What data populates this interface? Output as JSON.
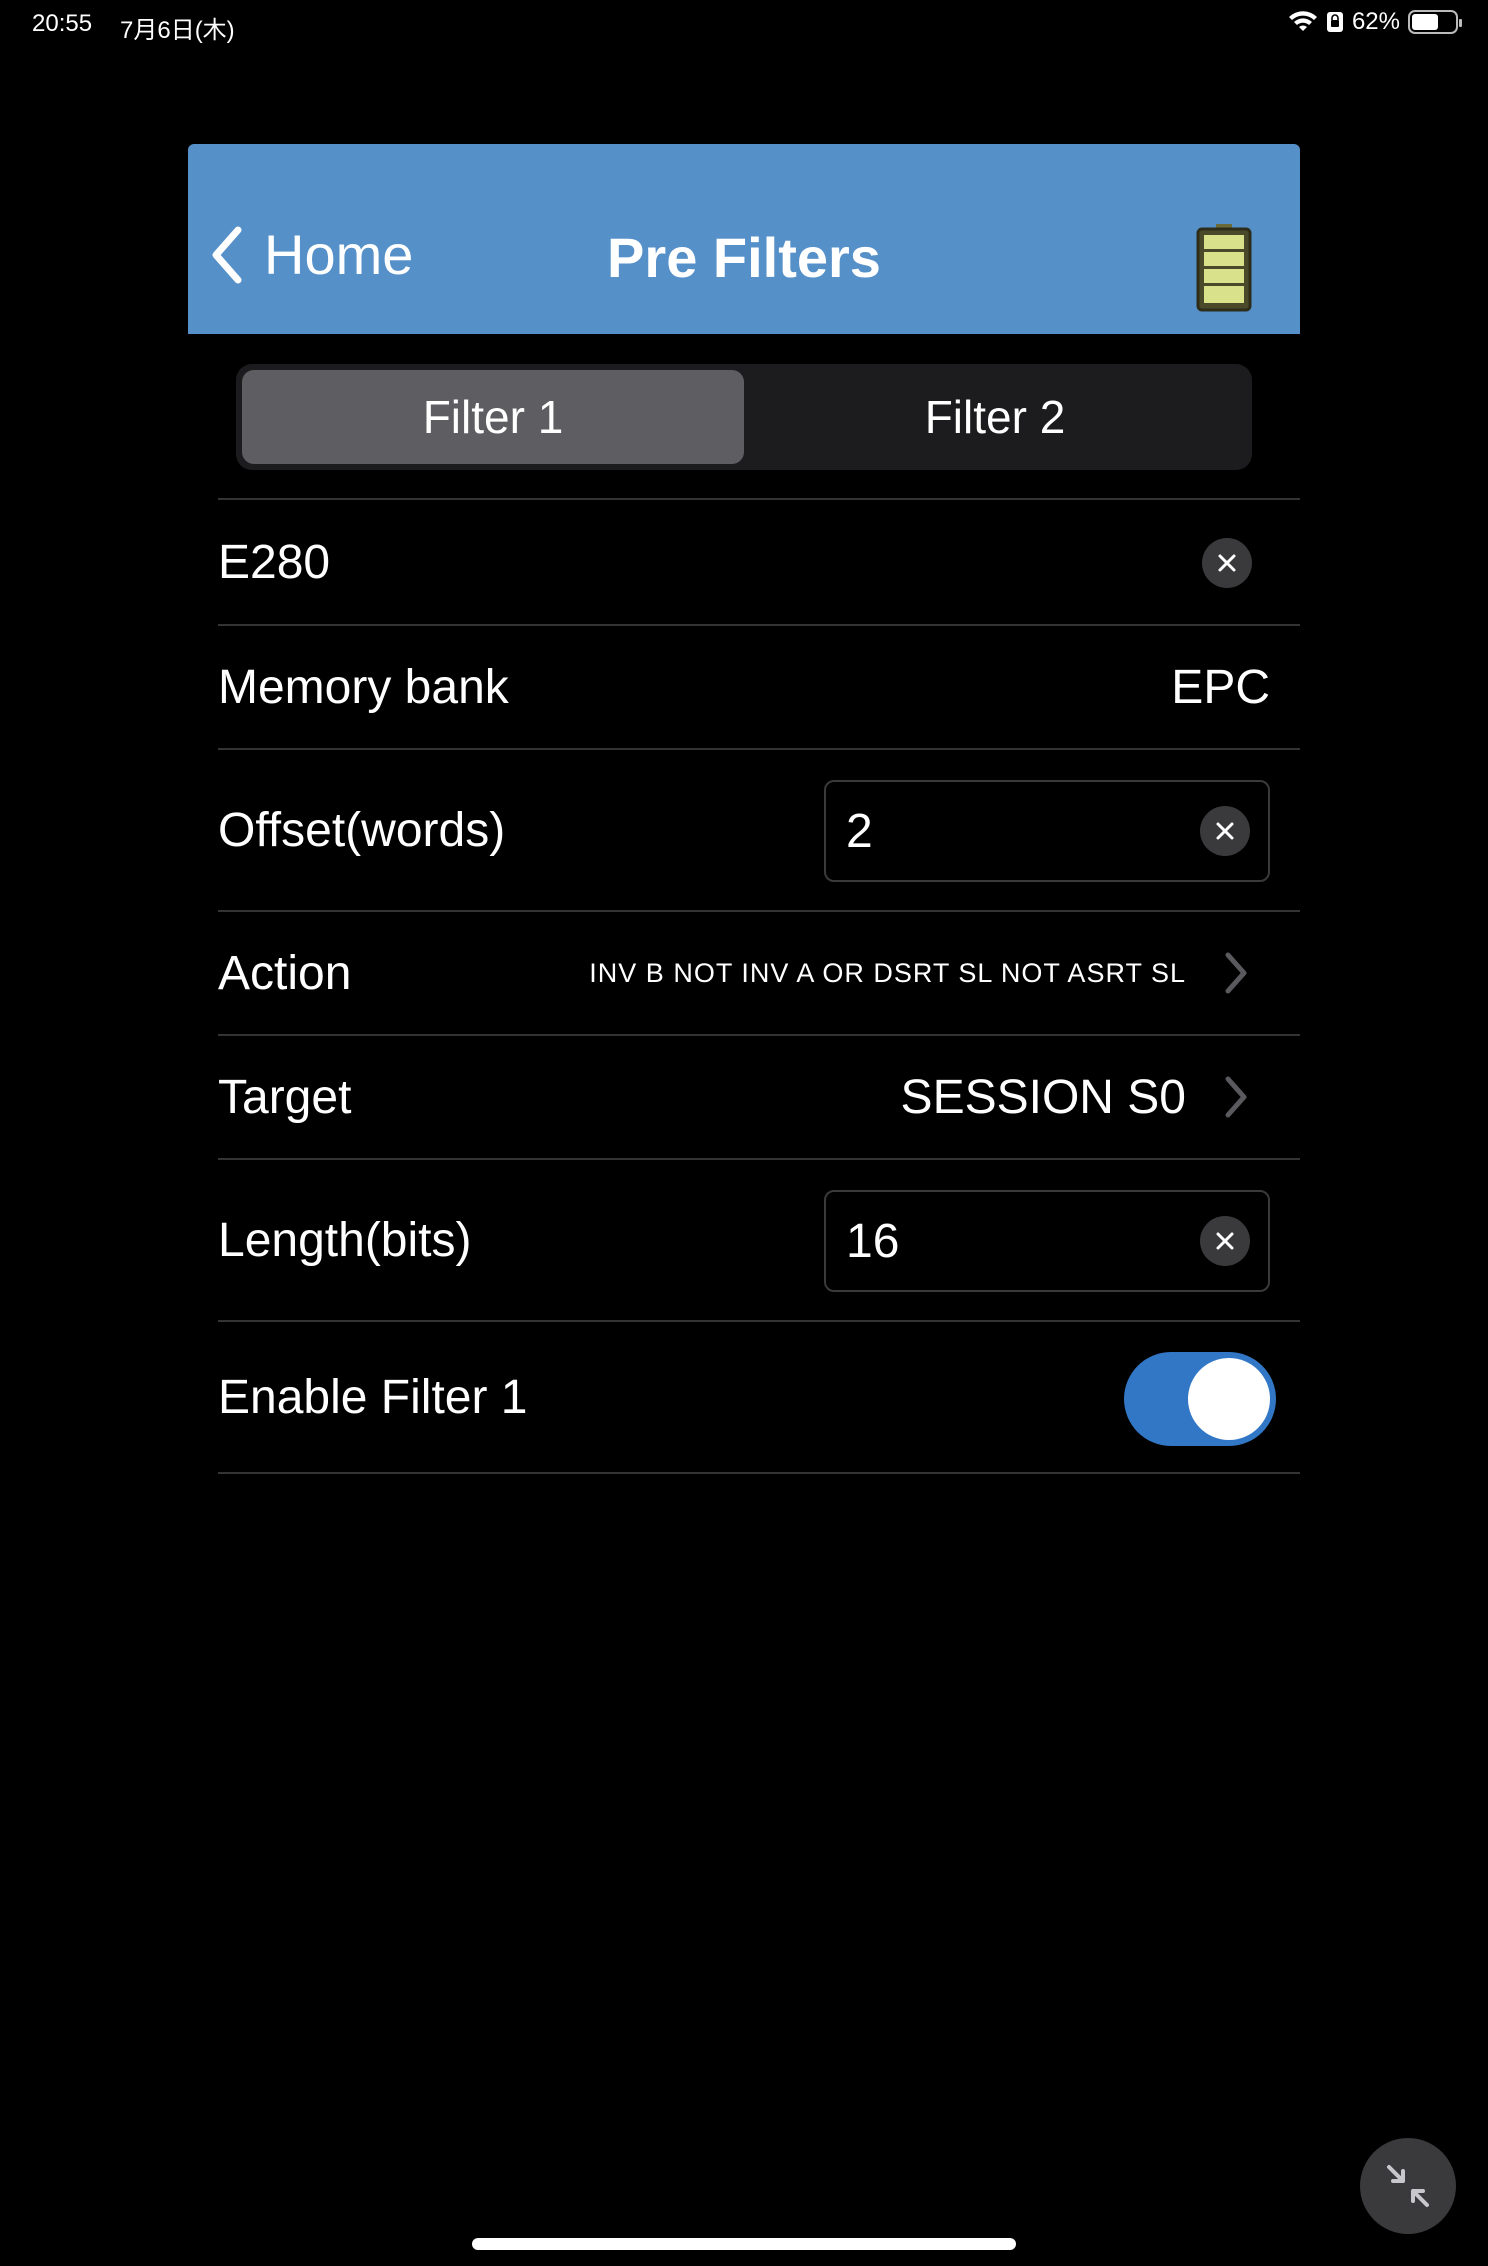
{
  "status_bar": {
    "time": "20:55",
    "date": "7月6日(木)",
    "battery_percent": "62%",
    "battery_level": 0.62,
    "icons": [
      "wifi-icon",
      "orientation-lock-icon",
      "battery-icon"
    ]
  },
  "navbar": {
    "back_label": "Home",
    "title": "Pre Filters",
    "background_color": "#5590c9",
    "right_icon": "reader-battery-icon"
  },
  "segments": {
    "items": [
      {
        "label": "Filter 1",
        "selected": true
      },
      {
        "label": "Filter 2",
        "selected": false
      }
    ]
  },
  "form": {
    "mask": {
      "value": "E280"
    },
    "memory_bank": {
      "label": "Memory bank",
      "value": "EPC"
    },
    "offset": {
      "label": "Offset(words)",
      "value": "2"
    },
    "action": {
      "label": "Action",
      "value": "INV B NOT INV A OR DSRT SL NOT ASRT SL"
    },
    "target": {
      "label": "Target",
      "value": "SESSION S0"
    },
    "length": {
      "label": "Length(bits)",
      "value": "16"
    },
    "enable": {
      "label": "Enable Filter 1",
      "on": true,
      "accent": "#3277c6"
    }
  },
  "floating": {
    "icon": "collapse-arrows-icon"
  }
}
